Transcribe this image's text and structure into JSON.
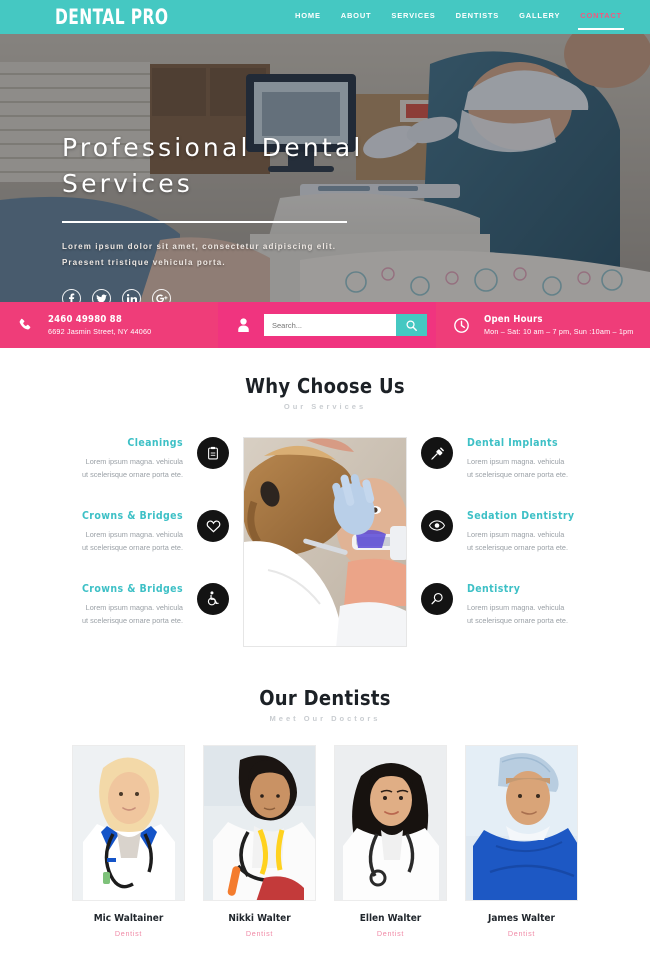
{
  "header": {
    "logo": "DENTAL PRO",
    "nav": [
      {
        "label": "HOME",
        "active": false
      },
      {
        "label": "ABOUT",
        "active": false
      },
      {
        "label": "SERVICES",
        "active": false
      },
      {
        "label": "DENTISTS",
        "active": false
      },
      {
        "label": "GALLERY",
        "active": false
      },
      {
        "label": "CONTACT",
        "active": true
      }
    ],
    "accent_teal": "#45c8c2",
    "accent_pink": "#f4577f"
  },
  "hero": {
    "title": "Professional Dental Services",
    "subtitle_line1": "Lorem ipsum dolor sit amet, consectetur adipiscing elit.",
    "subtitle_line2": "Praesent tristique vehicula porta.",
    "socials": [
      {
        "name": "facebook-icon",
        "glyph": "f"
      },
      {
        "name": "twitter-icon",
        "glyph": "t"
      },
      {
        "name": "linkedin-icon",
        "glyph": "in"
      },
      {
        "name": "google-plus-icon",
        "glyph": "G+"
      }
    ],
    "dots": [
      {
        "active": false
      },
      {
        "active": false
      },
      {
        "active": true
      }
    ],
    "dot_active_color": "#f4368a"
  },
  "infobar": {
    "phone": "2460 49980 88",
    "address": "6692 Jasmin Street, NY 44060",
    "search_placeholder": "Search...",
    "search_value": "",
    "hours_title": "Open Hours",
    "hours_value": "Mon – Sat: 10 am – 7 pm, Sun :10am – 1pm",
    "bg_color": "#ef3d79",
    "search_button_color": "#45c8c2"
  },
  "why_choose": {
    "title": "Why Choose Us",
    "subtitle": "Our Services",
    "left_services": [
      {
        "name": "Cleanings",
        "desc_line1": "Lorem ipsum magna. vehicula",
        "desc_line2": "ut scelerisque ornare porta ete.",
        "icon": "clipboard-icon"
      },
      {
        "name": "Crowns & Bridges",
        "desc_line1": "Lorem ipsum magna. vehicula",
        "desc_line2": "ut scelerisque ornare porta ete.",
        "icon": "heart-icon"
      },
      {
        "name": "Crowns & Bridges",
        "desc_line1": "Lorem ipsum magna. vehicula",
        "desc_line2": "ut scelerisque ornare porta ete.",
        "icon": "wheelchair-icon"
      }
    ],
    "right_services": [
      {
        "name": "Dental Implants",
        "desc_line1": "Lorem ipsum magna. vehicula",
        "desc_line2": "ut scelerisque ornare porta ete.",
        "icon": "syringe-icon"
      },
      {
        "name": "Sedation Dentistry",
        "desc_line1": "Lorem ipsum magna. vehicula",
        "desc_line2": "ut scelerisque ornare porta ete.",
        "icon": "eye-icon"
      },
      {
        "name": "Dentistry",
        "desc_line1": "Lorem ipsum magna. vehicula",
        "desc_line2": "ut scelerisque ornare porta ete.",
        "icon": "magnifier-icon"
      }
    ],
    "title_color": "#3dc0c6"
  },
  "dentists": {
    "title": "Our Dentists",
    "subtitle": "Meet Our Doctors",
    "doctors": [
      {
        "name": "Mic Waltainer",
        "role": "Dentist"
      },
      {
        "name": "Nikki Walter",
        "role": "Dentist"
      },
      {
        "name": "Ellen Walter",
        "role": "Dentist"
      },
      {
        "name": "James Walter",
        "role": "Dentist"
      }
    ],
    "role_color": "#f08aa6"
  }
}
